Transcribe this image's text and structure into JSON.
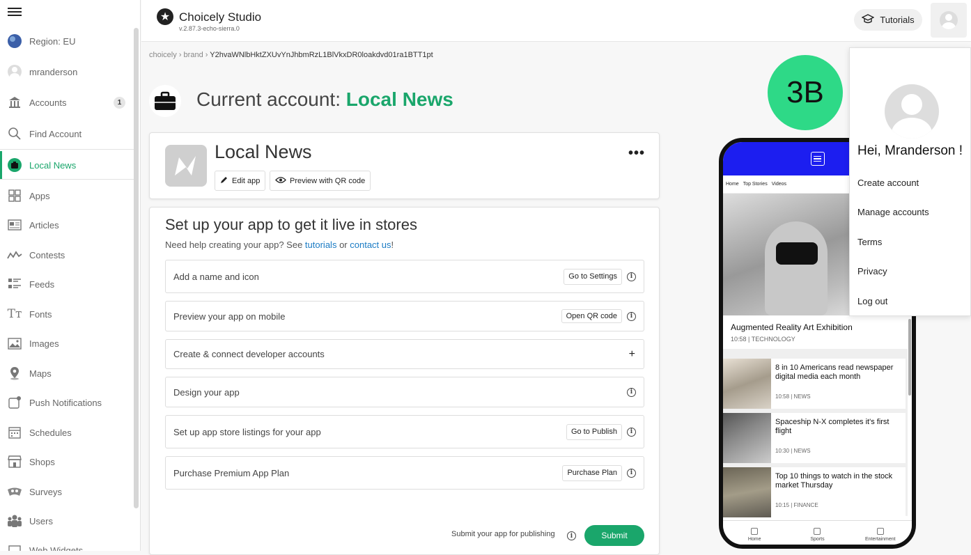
{
  "sidebar": {
    "region": "Region: EU",
    "user": "mranderson",
    "items": [
      {
        "label": "Accounts",
        "badge": "1",
        "icon": "bank-icon"
      },
      {
        "label": "Find Account",
        "icon": "search-icon"
      },
      {
        "label": "Local News",
        "icon": "briefcase-icon",
        "active": true
      },
      {
        "label": "Apps",
        "icon": "grid-icon"
      },
      {
        "label": "Articles",
        "icon": "article-icon"
      },
      {
        "label": "Contests",
        "icon": "contest-icon"
      },
      {
        "label": "Feeds",
        "icon": "feed-icon"
      },
      {
        "label": "Fonts",
        "icon": "font-icon"
      },
      {
        "label": "Images",
        "icon": "image-icon"
      },
      {
        "label": "Maps",
        "icon": "map-pin-icon"
      },
      {
        "label": "Push Notifications",
        "icon": "push-icon"
      },
      {
        "label": "Schedules",
        "icon": "calendar-icon"
      },
      {
        "label": "Shops",
        "icon": "shop-icon"
      },
      {
        "label": "Surveys",
        "icon": "survey-icon"
      },
      {
        "label": "Users",
        "icon": "users-icon"
      },
      {
        "label": "Web Widgets",
        "icon": "widget-icon"
      }
    ]
  },
  "header": {
    "title": "Choicely Studio",
    "version": "v.2.87.3-echo-sierra.0",
    "tutorials_label": "Tutorials"
  },
  "breadcrumb": {
    "parts": [
      "choicely",
      "brand",
      "Y2hvaWNlbHktZXUvYnJhbmRzL1BlVkxDR0loakdvd01ra1BTT1pt"
    ]
  },
  "account": {
    "prefix": "Current account: ",
    "name": "Local News"
  },
  "app_card": {
    "name": "Local News",
    "edit_label": "Edit app",
    "preview_label": "Preview with QR code",
    "more_label": "•••"
  },
  "setup": {
    "title": "Set up your app to get it live in stores",
    "help_prefix": "Need help creating your app? See ",
    "help_link1": "tutorials",
    "help_mid": " or ",
    "help_link2": "contact us",
    "help_suffix": "!",
    "steps": [
      {
        "label": "Add a name and icon",
        "action": "Go to Settings"
      },
      {
        "label": "Preview your app on mobile",
        "action": "Open QR code"
      },
      {
        "label": "Create & connect developer accounts",
        "action": "+"
      },
      {
        "label": "Design your app"
      },
      {
        "label": "Set up app store listings for your app",
        "action": "Go to Publish"
      },
      {
        "label": "Purchase Premium App Plan",
        "action": "Purchase Plan"
      }
    ],
    "submit_text": "Submit your app for publishing",
    "submit_label": "Submit"
  },
  "badge": "3B",
  "phone": {
    "tabs": [
      "Home",
      "Top Stories",
      "Videos"
    ],
    "hero_title": "Augmented Reality Art Exhibition",
    "hero_meta": "10:58 | TECHNOLOGY",
    "articles": [
      {
        "title": "8 in 10 Americans read newspaper digital media each month",
        "meta": "10:58 | NEWS"
      },
      {
        "title": "Spaceship N-X completes it's first flight",
        "meta": "10:30 | NEWS"
      },
      {
        "title": "Top 10 things to watch in the stock market Thursday",
        "meta": "10:15 | FINANCE"
      }
    ],
    "bottom": [
      "Home",
      "Sports",
      "Entertainment"
    ]
  },
  "dropdown": {
    "greeting": "Hei, Mranderson !",
    "items": [
      "Create account",
      "Manage accounts",
      "Terms",
      "Privacy",
      "Log out"
    ]
  },
  "colors": {
    "accent": "#1aa66b",
    "badge": "#2ed987",
    "phone_header": "#1c1ef0",
    "link": "#1a7bc4"
  }
}
